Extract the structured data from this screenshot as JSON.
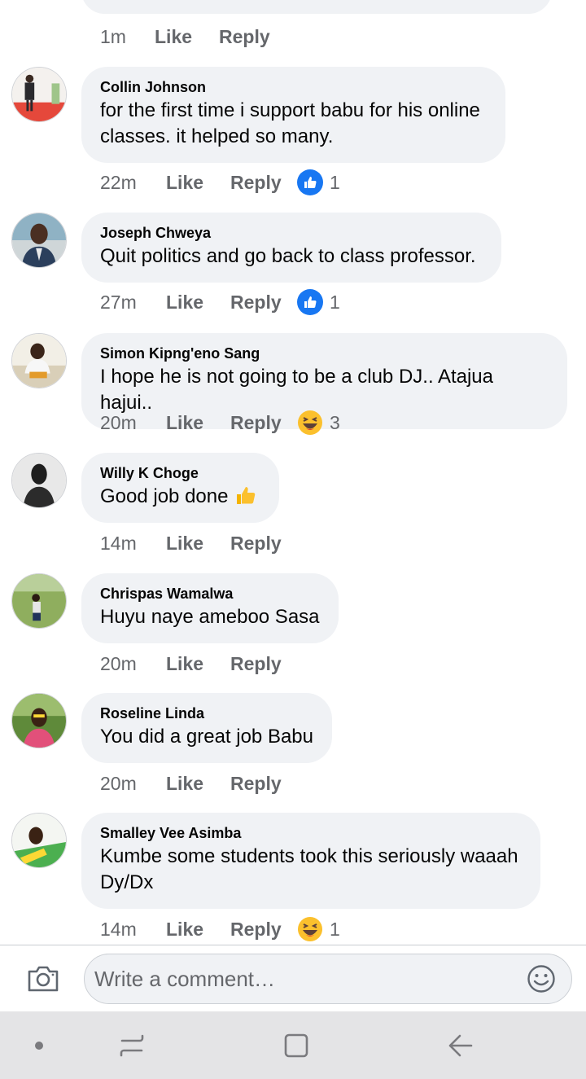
{
  "previous_comment": {
    "time": "1m",
    "like_label": "Like",
    "reply_label": "Reply"
  },
  "comments": [
    {
      "author": "Collin Johnson",
      "text": "for the first time i support babu for his online classes. it helped so many.",
      "time": "22m",
      "like_label": "Like",
      "reply_label": "Reply",
      "reaction": "like-icon",
      "reaction_count": "1"
    },
    {
      "author": "Joseph Chweya",
      "text": "Quit politics and go back to class professor.",
      "time": "27m",
      "like_label": "Like",
      "reply_label": "Reply",
      "reaction": "like-icon",
      "reaction_count": "1"
    },
    {
      "author": "Simon Kipng'eno Sang",
      "text": "I hope he is not going to be a club DJ.. Atajua hajui..",
      "time": "20m",
      "like_label": "Like",
      "reply_label": "Reply",
      "reaction": "haha-icon",
      "reaction_count": "3"
    },
    {
      "author": "Willy K Choge",
      "text": "Good job done",
      "time": "14m",
      "like_label": "Like",
      "reply_label": "Reply",
      "inline_emoji": "thumbs-up-icon"
    },
    {
      "author": "Chrispas Wamalwa",
      "text": "Huyu naye ameboo Sasa",
      "time": "20m",
      "like_label": "Like",
      "reply_label": "Reply"
    },
    {
      "author": "Roseline Linda",
      "text": "You did a great job Babu",
      "time": "20m",
      "like_label": "Like",
      "reply_label": "Reply"
    },
    {
      "author": "Smalley Vee Asimba",
      "text": "Kumbe some students took this seriously waaah Dy/Dx",
      "time": "14m",
      "like_label": "Like",
      "reply_label": "Reply",
      "reaction": "haha-icon",
      "reaction_count": "1"
    }
  ],
  "composer": {
    "placeholder": "Write a comment…",
    "camera_icon": "camera-icon",
    "emoji_icon": "smiley-icon"
  },
  "navbar": {
    "items": [
      "dot-icon",
      "recent-apps-icon",
      "home-icon",
      "back-icon"
    ]
  },
  "colors": {
    "bubble": "#f0f2f5",
    "meta_text": "#65676b",
    "like_blue": "#1877f2",
    "navbar_bg": "#e4e4e6"
  }
}
